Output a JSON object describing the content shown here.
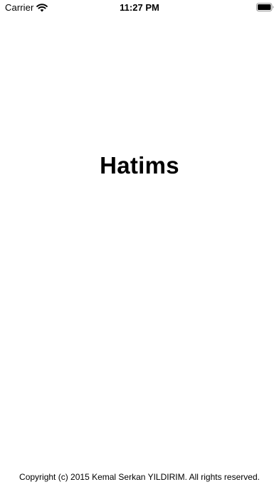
{
  "status_bar": {
    "carrier": "Carrier",
    "time": "11:27 PM",
    "signal_icon": "wifi-icon",
    "battery_icon": "battery-icon",
    "battery_level": 1.0
  },
  "launch_screen": {
    "title": "Hatims",
    "copyright": "Copyright (c) 2015 Kemal Serkan YILDIRIM. All rights reserved."
  }
}
